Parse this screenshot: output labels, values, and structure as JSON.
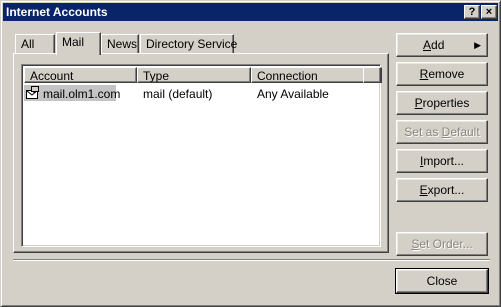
{
  "window": {
    "title": "Internet Accounts",
    "help_glyph": "?",
    "close_glyph": "×"
  },
  "tabs": [
    {
      "label": "All"
    },
    {
      "label": "Mail"
    },
    {
      "label": "News"
    },
    {
      "label": "Directory Service"
    }
  ],
  "list": {
    "columns": [
      "Account",
      "Type",
      "Connection"
    ],
    "rows": [
      {
        "account": "mail.olm1.com",
        "type": "mail (default)",
        "connection": "Any Available",
        "icon": "mail-server-icon"
      }
    ]
  },
  "buttons": {
    "add": {
      "label": "Add",
      "underline": "A",
      "rest": "dd",
      "arrow": "▶"
    },
    "remove": {
      "label": "Remove",
      "underline": "R",
      "rest": "emove"
    },
    "properties": {
      "label": "Properties",
      "underline": "P",
      "rest": "roperties"
    },
    "set_default": {
      "label": "Set as Default",
      "underline": "D",
      "pre": "Set as ",
      "rest": "efault",
      "enabled": false
    },
    "import": {
      "label": "Import...",
      "underline": "I",
      "rest": "mport..."
    },
    "export": {
      "label": "Export...",
      "underline": "E",
      "rest": "xport..."
    },
    "set_order": {
      "label": "Set Order...",
      "underline": "S",
      "rest": "et Order...",
      "enabled": false
    },
    "close": {
      "label": "Close"
    }
  },
  "colors": {
    "titlebar": "#0a246a",
    "face": "#d4d0c8",
    "selection": "#c4c4c4"
  }
}
